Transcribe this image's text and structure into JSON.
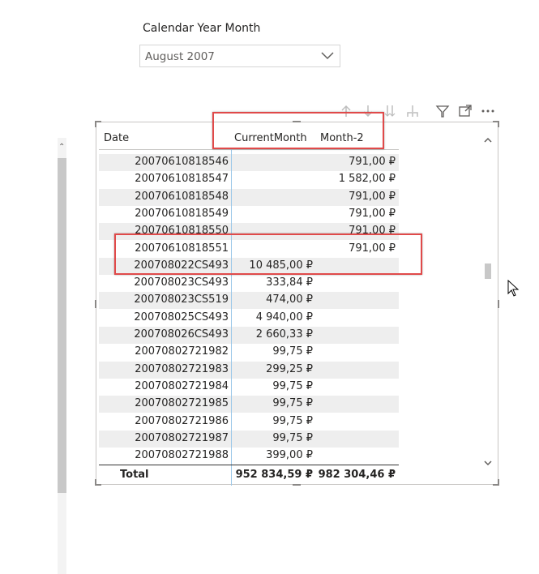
{
  "slicer": {
    "title": "Calendar Year Month",
    "value": "August 2007"
  },
  "icons": {
    "header": [
      "sort-ascending-icon",
      "sort-descending-icon",
      "expand-all-icon",
      "drill-down-icon",
      "filter-icon",
      "focus-mode-icon",
      "more-options-icon"
    ]
  },
  "table": {
    "headers": {
      "date": "Date",
      "current": "CurrentMonth",
      "month2": "Month-2"
    },
    "rows": [
      {
        "date": "20070610818546",
        "current": "",
        "month2": "791,00 ₽"
      },
      {
        "date": "20070610818547",
        "current": "",
        "month2": "1 582,00 ₽"
      },
      {
        "date": "20070610818548",
        "current": "",
        "month2": "791,00 ₽"
      },
      {
        "date": "20070610818549",
        "current": "",
        "month2": "791,00 ₽"
      },
      {
        "date": "20070610818550",
        "current": "",
        "month2": "791,00 ₽"
      },
      {
        "date": "20070610818551",
        "current": "",
        "month2": "791,00 ₽"
      },
      {
        "date": "200708022CS493",
        "current": "10 485,00 ₽",
        "month2": ""
      },
      {
        "date": "200708023CS493",
        "current": "333,84 ₽",
        "month2": ""
      },
      {
        "date": "200708023CS519",
        "current": "474,00 ₽",
        "month2": ""
      },
      {
        "date": "200708025CS493",
        "current": "4 940,00 ₽",
        "month2": ""
      },
      {
        "date": "200708026CS493",
        "current": "2 660,33 ₽",
        "month2": ""
      },
      {
        "date": "20070802721982",
        "current": "99,75 ₽",
        "month2": ""
      },
      {
        "date": "20070802721983",
        "current": "299,25 ₽",
        "month2": ""
      },
      {
        "date": "20070802721984",
        "current": "99,75 ₽",
        "month2": ""
      },
      {
        "date": "20070802721985",
        "current": "99,75 ₽",
        "month2": ""
      },
      {
        "date": "20070802721986",
        "current": "99,75 ₽",
        "month2": ""
      },
      {
        "date": "20070802721987",
        "current": "99,75 ₽",
        "month2": ""
      },
      {
        "date": "20070802721988",
        "current": "399,00 ₽",
        "month2": ""
      }
    ],
    "total": {
      "label": "Total",
      "current": "952 834,59 ₽",
      "month2": "982 304,46 ₽"
    }
  },
  "colors": {
    "highlight_red": "#e04a4a",
    "column_separator": "#9bc7e8",
    "row_stripe": "#eeeeee"
  }
}
